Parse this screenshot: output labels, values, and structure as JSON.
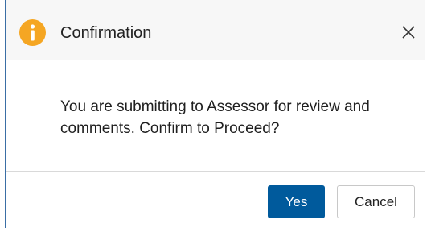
{
  "dialog": {
    "title": "Confirmation",
    "icon": "info-icon",
    "close_icon": "close-icon",
    "message": "You are submitting to Assessor for review and comments. Confirm to Proceed?",
    "buttons": {
      "yes_label": "Yes",
      "cancel_label": "Cancel"
    }
  },
  "colors": {
    "icon": "#f5a623",
    "primary_button": "#005a9c",
    "header_bg": "#f7f7f7",
    "dialog_border": "#3a6ea5"
  }
}
